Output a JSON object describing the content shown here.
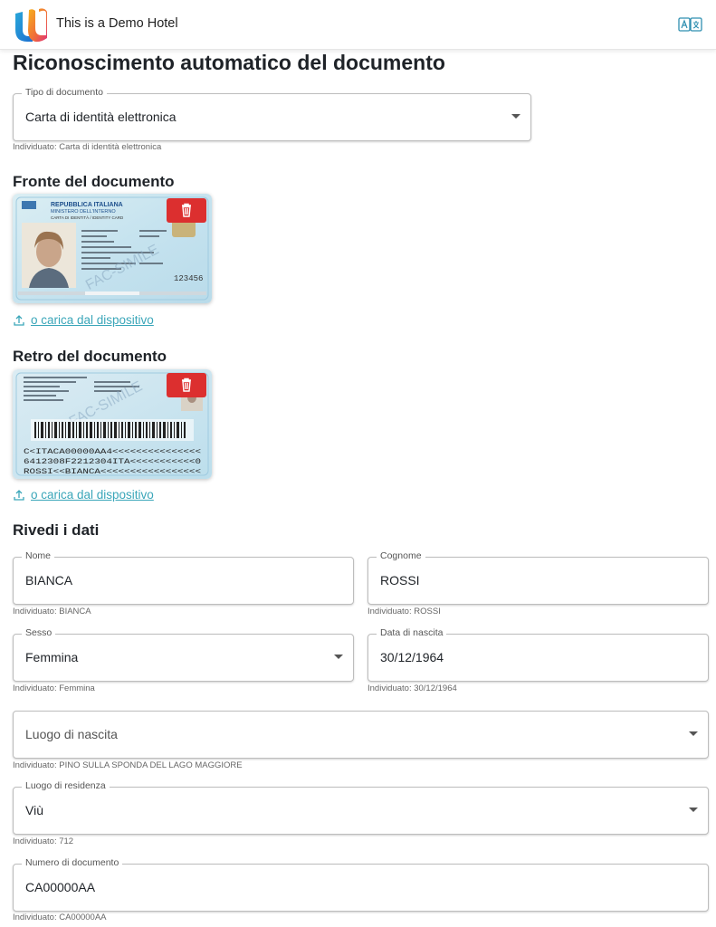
{
  "header": {
    "hotel_name": "This is a Demo Hotel",
    "logo_icon": "brand-logo-icon",
    "translate_icon": "translate-icon"
  },
  "page": {
    "title": "Riconoscimento automatico del documento"
  },
  "document_type": {
    "label": "Tipo di documento",
    "value": "Carta di identità elettronica",
    "hint": "Individuato: Carta di identità elettronica"
  },
  "front": {
    "heading": "Fronte del documento",
    "upload_label": "o carica dal dispositivo",
    "card": {
      "header_line1": "REPUBBLICA ITALIANA",
      "header_line2": "MINISTERO DELL'INTERNO",
      "subtitle": "CARTA DI IDENTITÀ / IDENTITY CARD",
      "watermark": "FAC-SIMILE",
      "number": "123456"
    }
  },
  "back": {
    "heading": "Retro del documento",
    "upload_label": "o carica dal dispositivo",
    "card": {
      "watermark": "FAC-SIMILE",
      "mrz_line1": "C<ITACA00000AA4<<<<<<<<<<<<<<<",
      "mrz_line2": "6412308F2212304ITA<<<<<<<<<<<0",
      "mrz_line3": "ROSSI<<BIANCA<<<<<<<<<<<<<<<<<"
    }
  },
  "review": {
    "heading": "Rivedi i dati",
    "nome": {
      "label": "Nome",
      "value": "BIANCA",
      "hint": "Individuato: BIANCA"
    },
    "cognome": {
      "label": "Cognome",
      "value": "ROSSI",
      "hint": "Individuato: ROSSI"
    },
    "sesso": {
      "label": "Sesso",
      "value": "Femmina",
      "hint": "Individuato: Femmina"
    },
    "data_nascita": {
      "label": "Data di nascita",
      "value": "30/12/1964",
      "hint": "Individuato: 30/12/1964"
    },
    "luogo_nascita": {
      "placeholder": "Luogo di nascita",
      "hint": "Individuato: PINO SULLA SPONDA DEL LAGO MAGGIORE"
    },
    "luogo_residenza": {
      "label": "Luogo di residenza",
      "value": "Viù",
      "hint": "Individuato: 712"
    },
    "numero_documento": {
      "label": "Numero di documento",
      "value": "CA00000AA",
      "hint": "Individuato: CA00000AA"
    }
  },
  "colors": {
    "delete": "#dc2f2f",
    "link": "#3aa6b9"
  }
}
